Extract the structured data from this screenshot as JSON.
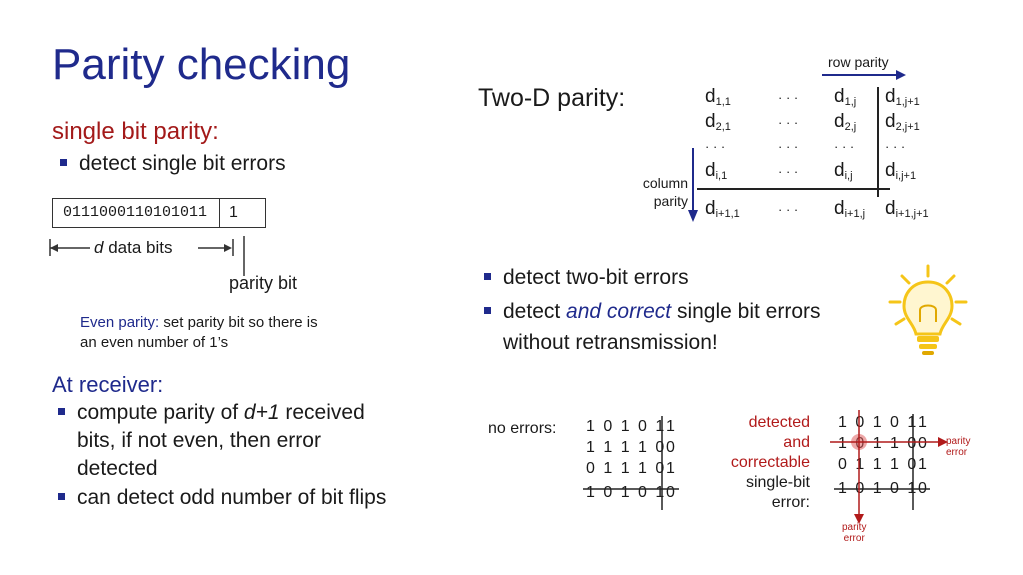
{
  "title": "Parity checking",
  "left": {
    "heading": "single bit parity:",
    "bullet1": "detect single bit errors",
    "data_bits": "0111000110101011",
    "parity_bit_value": "1",
    "d_label_italic": "d",
    "d_label_rest": " data bits",
    "parity_bit_label": "parity bit",
    "even_label": "Even parity:",
    "even_text_1": " set parity bit so there is",
    "even_text_2": "an even number of 1’s",
    "receiver_heading": "At receiver:",
    "r1_a": "compute parity of ",
    "r1_b": "d+1",
    "r1_c": " received",
    "r1_line2": "bits, if not even, then error",
    "r1_line3": "detected",
    "r2": "can detect odd number of bit flips"
  },
  "right": {
    "two_d_label": "Two-D parity:",
    "row_parity": "row parity",
    "column_parity_1": "column",
    "column_parity_2": "parity",
    "dots": "· · ·",
    "matrix": [
      [
        {
          "b": "d",
          "s": "1,1"
        },
        {
          "t": "· · ·"
        },
        {
          "b": "d",
          "s": "1,j"
        },
        {
          "b": "d",
          "s": "1,j+1"
        }
      ],
      [
        {
          "b": "d",
          "s": "2,1"
        },
        {
          "t": "· · ·"
        },
        {
          "b": "d",
          "s": "2,j"
        },
        {
          "b": "d",
          "s": "2,j+1"
        }
      ],
      [
        {
          "t": "· · ·"
        },
        {
          "t": "· · ·"
        },
        {
          "t": "· · ·"
        },
        {
          "t": "· · ·"
        }
      ],
      [
        {
          "b": "d",
          "s": "i,1"
        },
        {
          "t": "· · ·"
        },
        {
          "b": "d",
          "s": "i,j"
        },
        {
          "b": "d",
          "s": "i,j+1"
        }
      ],
      [
        {
          "b": "d",
          "s": "i+1,1"
        },
        {
          "t": "· · ·"
        },
        {
          "b": "d",
          "s": "i+1,j"
        },
        {
          "b": "d",
          "s": "i+1,j+1"
        }
      ]
    ],
    "bullet1": "detect two-bit errors",
    "bullet2_a": "detect ",
    "bullet2_b": "and correct",
    "bullet2_c": " single bit errors",
    "bullet2_line2": "without retransmission!",
    "no_errors_label": "no errors:",
    "no_errors_rows": [
      {
        "data": "1 0 1 0 1",
        "p": "1"
      },
      {
        "data": "1 1 1 1 0",
        "p": "0"
      },
      {
        "data": "0 1 1 1 0",
        "p": "1"
      },
      {
        "data": "1 0 1 0 1",
        "p": "0"
      }
    ],
    "err_label_lines": [
      "detected",
      "and",
      "correctable"
    ],
    "err_label_lines_black": [
      "single-bit",
      "error:"
    ],
    "err_rows": [
      {
        "data": "1 0 1 0 1",
        "p": "1"
      },
      {
        "data": "1 0 1 1 0",
        "p": "0"
      },
      {
        "data": "0 1 1 1 0",
        "p": "1"
      },
      {
        "data": "1 0 1 0 1",
        "p": "0"
      }
    ],
    "parity_error_1": "parity",
    "parity_error_2": "error",
    "colors": {
      "blue": "#1f2a8c",
      "red": "#b11a1a",
      "bulb": "#f5c518"
    }
  }
}
